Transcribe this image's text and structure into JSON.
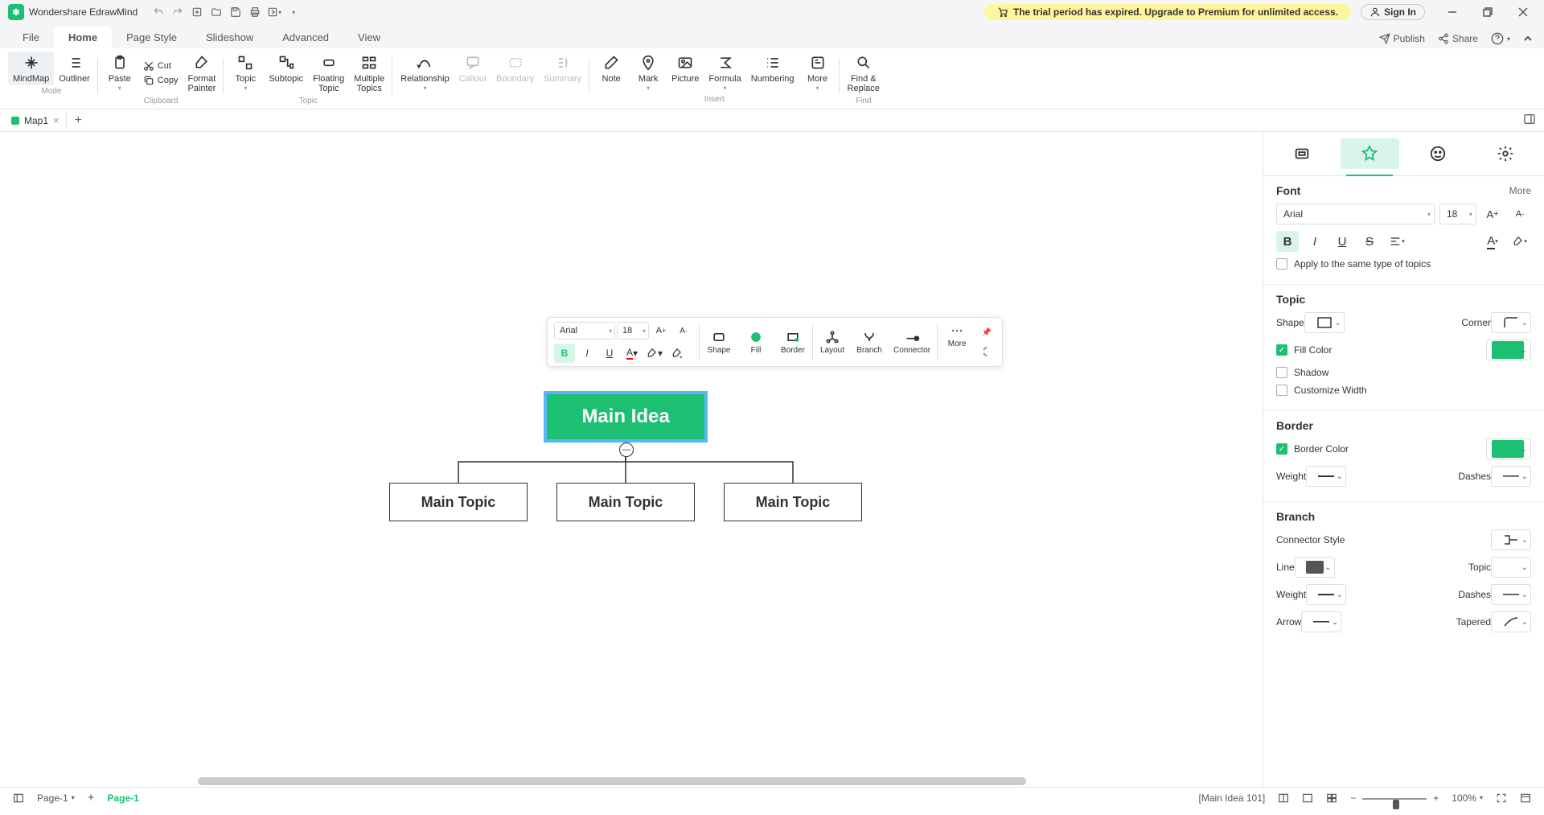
{
  "app": {
    "title": "Wondershare EdrawMind"
  },
  "trial": {
    "text": "The trial period has expired. Upgrade to Premium for unlimited access."
  },
  "signin": {
    "label": "Sign In"
  },
  "menu": {
    "tabs": [
      "File",
      "Home",
      "Page Style",
      "Slideshow",
      "Advanced",
      "View"
    ],
    "active": 1,
    "publish": "Publish",
    "share": "Share"
  },
  "ribbon": {
    "mode": {
      "label": "Mode",
      "mindmap": "MindMap",
      "outliner": "Outliner"
    },
    "clipboard": {
      "label": "Clipboard",
      "paste": "Paste",
      "cut": "Cut",
      "copy": "Copy",
      "format_painter": "Format\nPainter"
    },
    "topic": {
      "label": "Topic",
      "topic": "Topic",
      "subtopic": "Subtopic",
      "floating": "Floating\nTopic",
      "multiple": "Multiple\nTopics"
    },
    "relationship": "Relationship",
    "callout": "Callout",
    "boundary": "Boundary",
    "summary": "Summary",
    "insert": {
      "label": "Insert",
      "note": "Note",
      "mark": "Mark",
      "picture": "Picture",
      "formula": "Formula",
      "numbering": "Numbering",
      "more": "More"
    },
    "find": {
      "label": "Find",
      "findreplace": "Find &\nReplace"
    }
  },
  "doc": {
    "name": "Map1"
  },
  "floatingToolbar": {
    "font": "Arial",
    "size": "18",
    "shape": "Shape",
    "fill": "Fill",
    "border": "Border",
    "layout": "Layout",
    "branch": "Branch",
    "connector": "Connector",
    "more": "More"
  },
  "mindmap": {
    "main": "Main Idea",
    "topics": [
      "Main Topic",
      "Main Topic",
      "Main Topic"
    ]
  },
  "panel": {
    "font": {
      "title": "Font",
      "more": "More",
      "family": "Arial",
      "size": "18",
      "applySame": "Apply to the same type of topics"
    },
    "topic": {
      "title": "Topic",
      "shape": "Shape",
      "corner": "Corner",
      "fillColor": "Fill Color",
      "shadow": "Shadow",
      "customize": "Customize Width"
    },
    "border": {
      "title": "Border",
      "borderColor": "Border Color",
      "weight": "Weight",
      "dashes": "Dashes"
    },
    "branch": {
      "title": "Branch",
      "connectorStyle": "Connector Style",
      "line": "Line",
      "topic": "Topic",
      "weight": "Weight",
      "dashes": "Dashes",
      "arrow": "Arrow",
      "tapered": "Tapered"
    }
  },
  "status": {
    "pageSelector": "Page-1",
    "pageLink": "Page-1",
    "selection": "[Main Idea 101]",
    "zoom": "100%"
  }
}
